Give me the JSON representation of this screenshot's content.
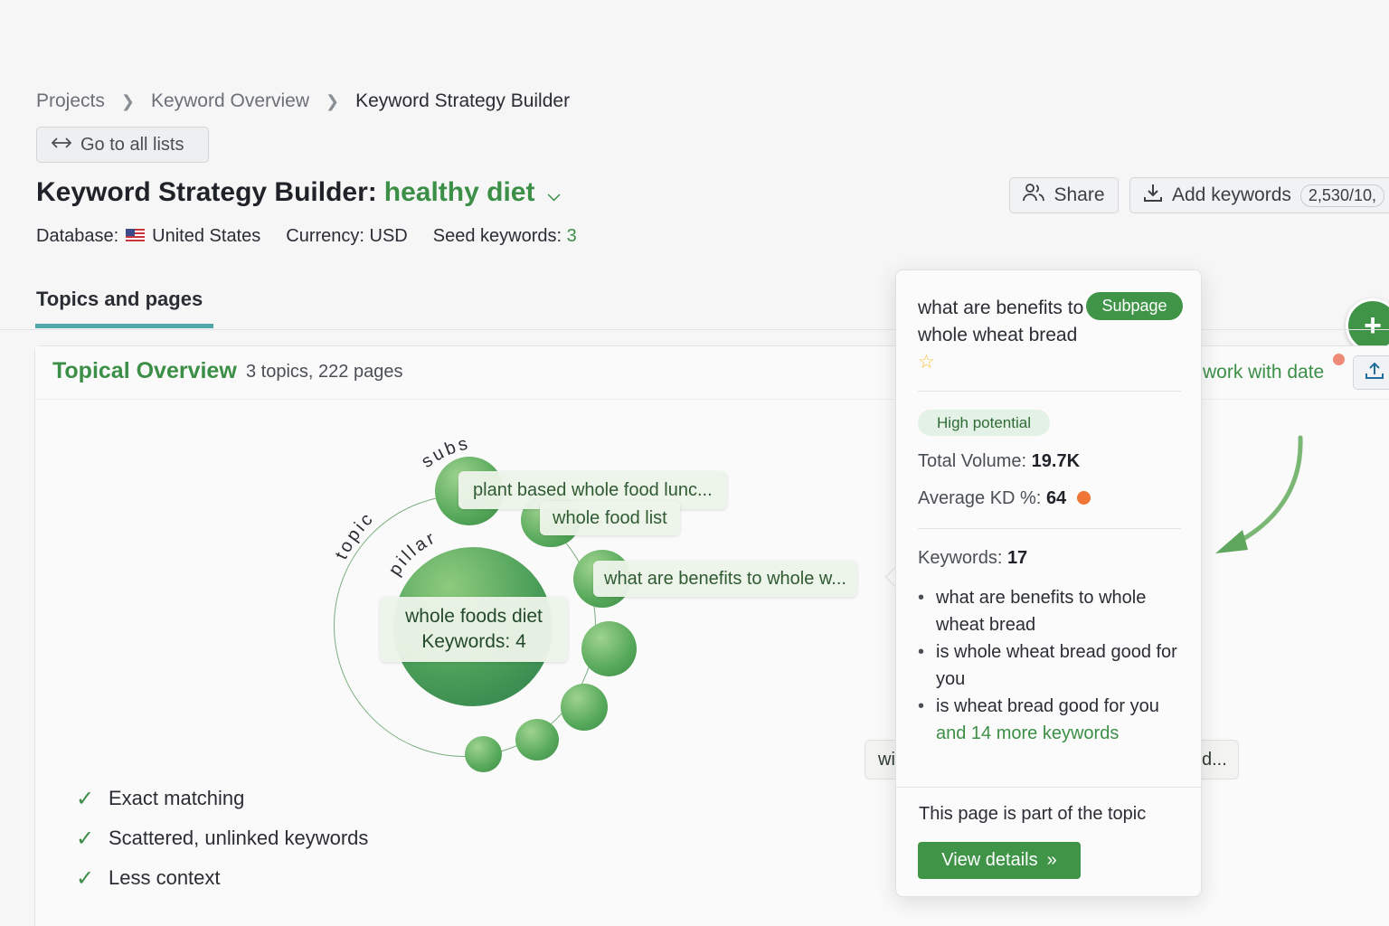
{
  "breadcrumb": {
    "items": [
      "Projects",
      "Keyword Overview",
      "Keyword Strategy Builder"
    ]
  },
  "go_lists_label": "Go to all lists",
  "header": {
    "title_prefix": "Keyword Strategy Builder:",
    "title_topic": "healthy diet"
  },
  "meta": {
    "database_label": "Database:",
    "database_value": "United States",
    "currency": "Currency: USD",
    "seed_label": "Seed keywords:",
    "seed_value": "3"
  },
  "actions": {
    "share_label": "Share",
    "add_keywords_label": "Add keywords",
    "add_keywords_count": "2,530/10,"
  },
  "tabs": {
    "active": "Topics and pages"
  },
  "overview": {
    "title": "Topical Overview",
    "subtitle": "3 topics, 222 pages",
    "date_link": "work with date"
  },
  "diagram": {
    "ring_labels": {
      "subs": "subs",
      "topic": "topic",
      "pillar": "pillar"
    },
    "pillar_name": "whole foods diet",
    "pillar_keywords": "Keywords: 4",
    "bubbles": [
      "plant based whole food lunc...",
      "whole food list",
      "what are benefits to whole w..."
    ],
    "partial_left": "wi",
    "partial_right": "d..."
  },
  "checklist": [
    "Exact matching",
    "Scattered, unlinked keywords",
    "Less context"
  ],
  "popover": {
    "title": "what are benefits to whole wheat bread",
    "badge": "Subpage",
    "potential": "High potential",
    "volume_label": "Total Volume:",
    "volume_value": "19.7K",
    "kd_label": "Average KD %:",
    "kd_value": "64",
    "keywords_label": "Keywords:",
    "keywords_value": "17",
    "keywords": [
      "what are benefits to whole wheat bread",
      "is whole wheat bread good for you",
      "is wheat bread good for you"
    ],
    "more": "and 14 more keywords",
    "part_of": "This page is part of the topic",
    "view_details": "View details"
  },
  "colors": {
    "accent_green": "#3f9448",
    "kd_orange": "#ee7536",
    "tab_underline": "#4fa7a8"
  }
}
